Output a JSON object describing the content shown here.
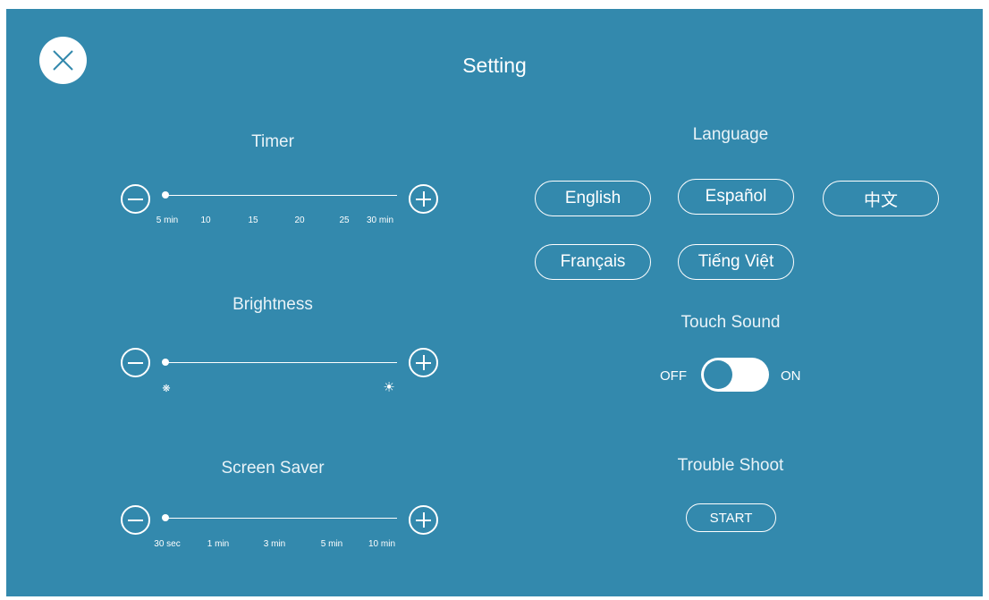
{
  "title": "Setting",
  "close_icon": "close-x-icon",
  "timer": {
    "label": "Timer",
    "ticks": [
      "5 min",
      "10",
      "15",
      "20",
      "25",
      "30 min"
    ],
    "value": "5 min"
  },
  "brightness": {
    "label": "Brightness",
    "low_icon": "dim-sun-icon",
    "high_icon": "bright-sun-icon",
    "low_glyph": "❋",
    "high_glyph": "☀",
    "value": 0.0
  },
  "screen_saver": {
    "label": "Screen Saver",
    "ticks": [
      "30 sec",
      "1 min",
      "3 min",
      "5 min",
      "10 min"
    ],
    "value": "30 sec"
  },
  "language": {
    "label": "Language",
    "options": [
      "English",
      "Español",
      "中文",
      "Français",
      "Tiếng Việt"
    ],
    "selected": "English"
  },
  "touch_sound": {
    "label": "Touch Sound",
    "off_label": "OFF",
    "on_label": "ON",
    "state": "ON"
  },
  "trouble_shoot": {
    "label": "Trouble Shoot",
    "button": "START"
  },
  "colors": {
    "background": "#3389ad",
    "foreground": "#ffffff"
  }
}
